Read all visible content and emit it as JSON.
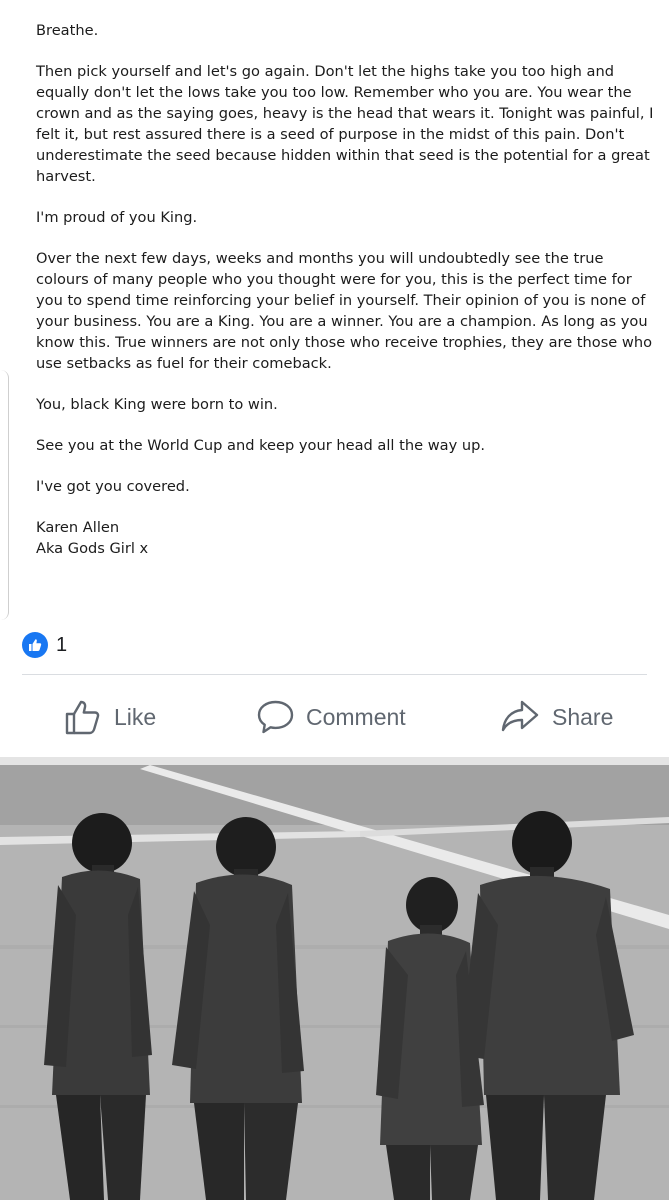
{
  "post": {
    "paragraphs": [
      "Breathe.",
      "Then pick yourself and let's go again. Don't let the highs take you too high and equally don't let the lows take you too low. Remember who you are. You wear the crown and as the saying goes, heavy is the head that wears it. Tonight was painful, I felt it, but rest assured there is a seed of purpose in the midst of this pain. Don't underestimate the seed because hidden within that seed is the potential for a great harvest.",
      "I'm proud of you King.",
      "Over the next few days, weeks and months you will undoubtedly see the true colours of many people who you thought were for you, this is the perfect time for you to spend time reinforcing your belief in yourself. Their opinion of you is none of your business. You are a King. You are a winner. You are a champion. As long as you know this. True winners are not only those who receive trophies, they are those who use setbacks as fuel for their comeback.",
      "You, black King were born to win.",
      "See you at the World Cup and keep your head all the way up.",
      "I've got you covered."
    ],
    "signature": {
      "name": "Karen Allen",
      "alias": "Aka Gods Girl x"
    }
  },
  "reactions": {
    "icon": "like-reaction-icon",
    "count": "1",
    "color": "#1877f2"
  },
  "actions": {
    "like_label": "Like",
    "comment_label": "Comment",
    "share_label": "Share"
  },
  "photo": {
    "icon": "team-photo"
  }
}
